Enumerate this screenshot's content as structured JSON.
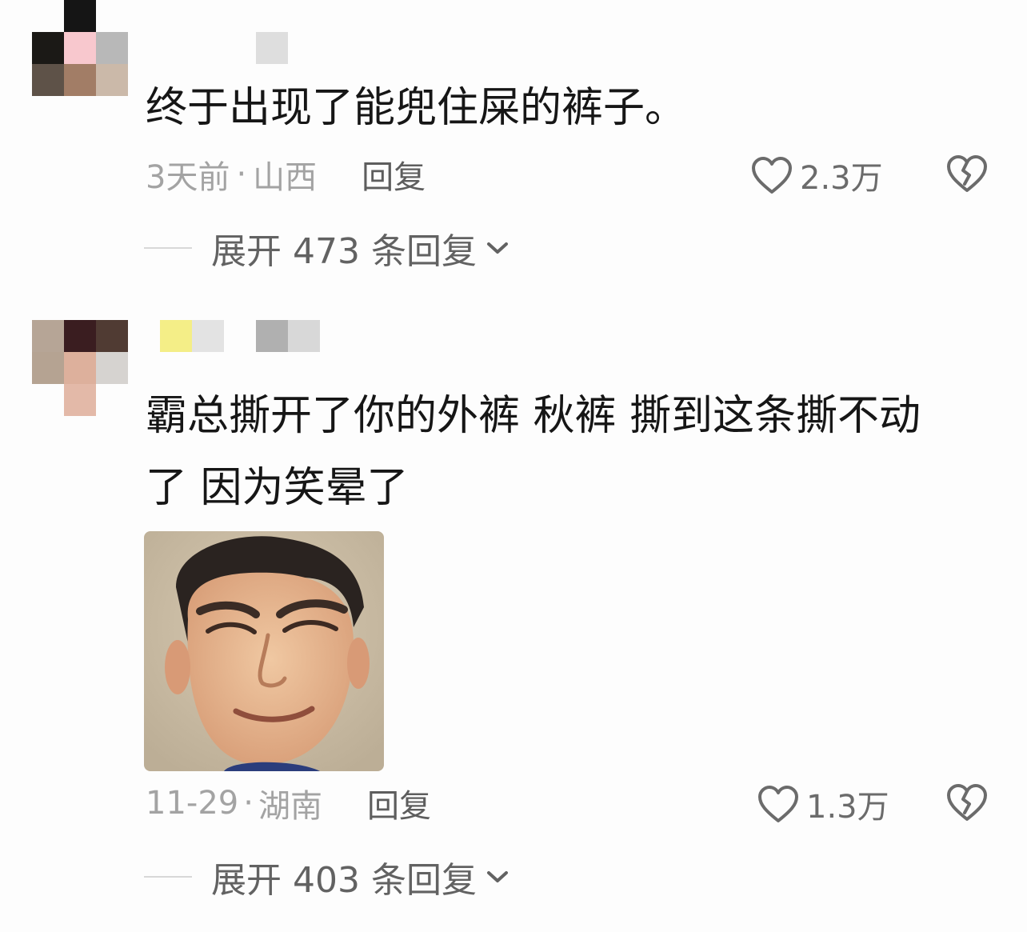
{
  "comments": [
    {
      "text": "终于出现了能兜住屎的裤子。",
      "time": "3天前",
      "location": "山西",
      "reply_label": "回复",
      "likes": "2.3万",
      "expand_label": "展开 473 条回复",
      "avatar_colors": [
        "#fdfdfd",
        "#151515",
        "#fdfdfd",
        "#1b1916",
        "#f8c8ce",
        "#b8b8b8",
        "#5e5248",
        "#a27d66",
        "#cbb9a9"
      ],
      "name_colors": [
        "#fdfdfd",
        "#fdfdfd",
        "#fdfdfd",
        "#dedede"
      ]
    },
    {
      "text": "霸总撕开了你的外裤 秋裤 撕到这条撕不动了 因为笑晕了",
      "time": "11-29",
      "location": "湖南",
      "reply_label": "回复",
      "likes": "1.3万",
      "expand_label": "展开 403 条回复",
      "avatar_colors": [
        "#b6a596",
        "#3a1d20",
        "#503b33",
        "#b5a392",
        "#ddb09c",
        "#d6d3d0",
        "#fdfdfd",
        "#e3b9a8",
        "#fdfdfd"
      ],
      "name_colors": [
        "#f4ee87",
        "#e3e3e3",
        "#fdfdfd",
        "#b0b0b0",
        "#d8d8d8"
      ]
    }
  ],
  "meta_separator": "·",
  "icons": {
    "like": "heart-outline-icon",
    "dislike": "broken-heart-icon",
    "expand": "chevron-down-icon"
  }
}
